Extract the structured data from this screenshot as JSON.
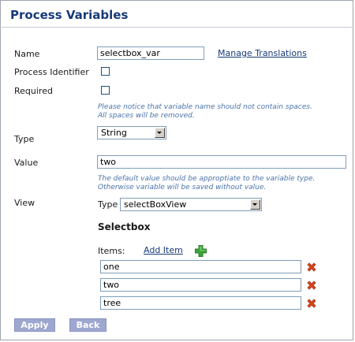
{
  "page": {
    "title": "Process Variables"
  },
  "form": {
    "name_label": "Name",
    "name_value": "selectbox_var",
    "manage_translations": "Manage Translations",
    "process_identifier_label": "Process Identifier",
    "process_identifier_checked": false,
    "required_label": "Required",
    "required_checked": false,
    "name_hint_line1": "Please notice that variable name should not contain spaces.",
    "name_hint_line2": "All spaces will be removed.",
    "type_label": "Type",
    "type_value": "String",
    "value_label": "Value",
    "value_value": "two",
    "value_hint_line1": "The default value should be approptiate to the variable type.",
    "value_hint_line2": "Otherwise variable will be saved without value.",
    "view_label": "View",
    "view_type_label": "Type",
    "view_type_value": "selectBoxView"
  },
  "selectbox": {
    "title": "Selectbox",
    "items_label": "Items:",
    "add_item": "Add Item",
    "items": [
      "one",
      "two",
      "tree"
    ]
  },
  "actions": {
    "apply": "Apply",
    "back": "Back"
  },
  "icons": {
    "add": "plus-icon",
    "delete": "delete-x-icon"
  },
  "colors": {
    "title": "#173a78",
    "hint": "#4b74aa",
    "button": "#9ea7cf",
    "add_icon": "#3aa33a",
    "delete_icon": "#d9461e"
  }
}
